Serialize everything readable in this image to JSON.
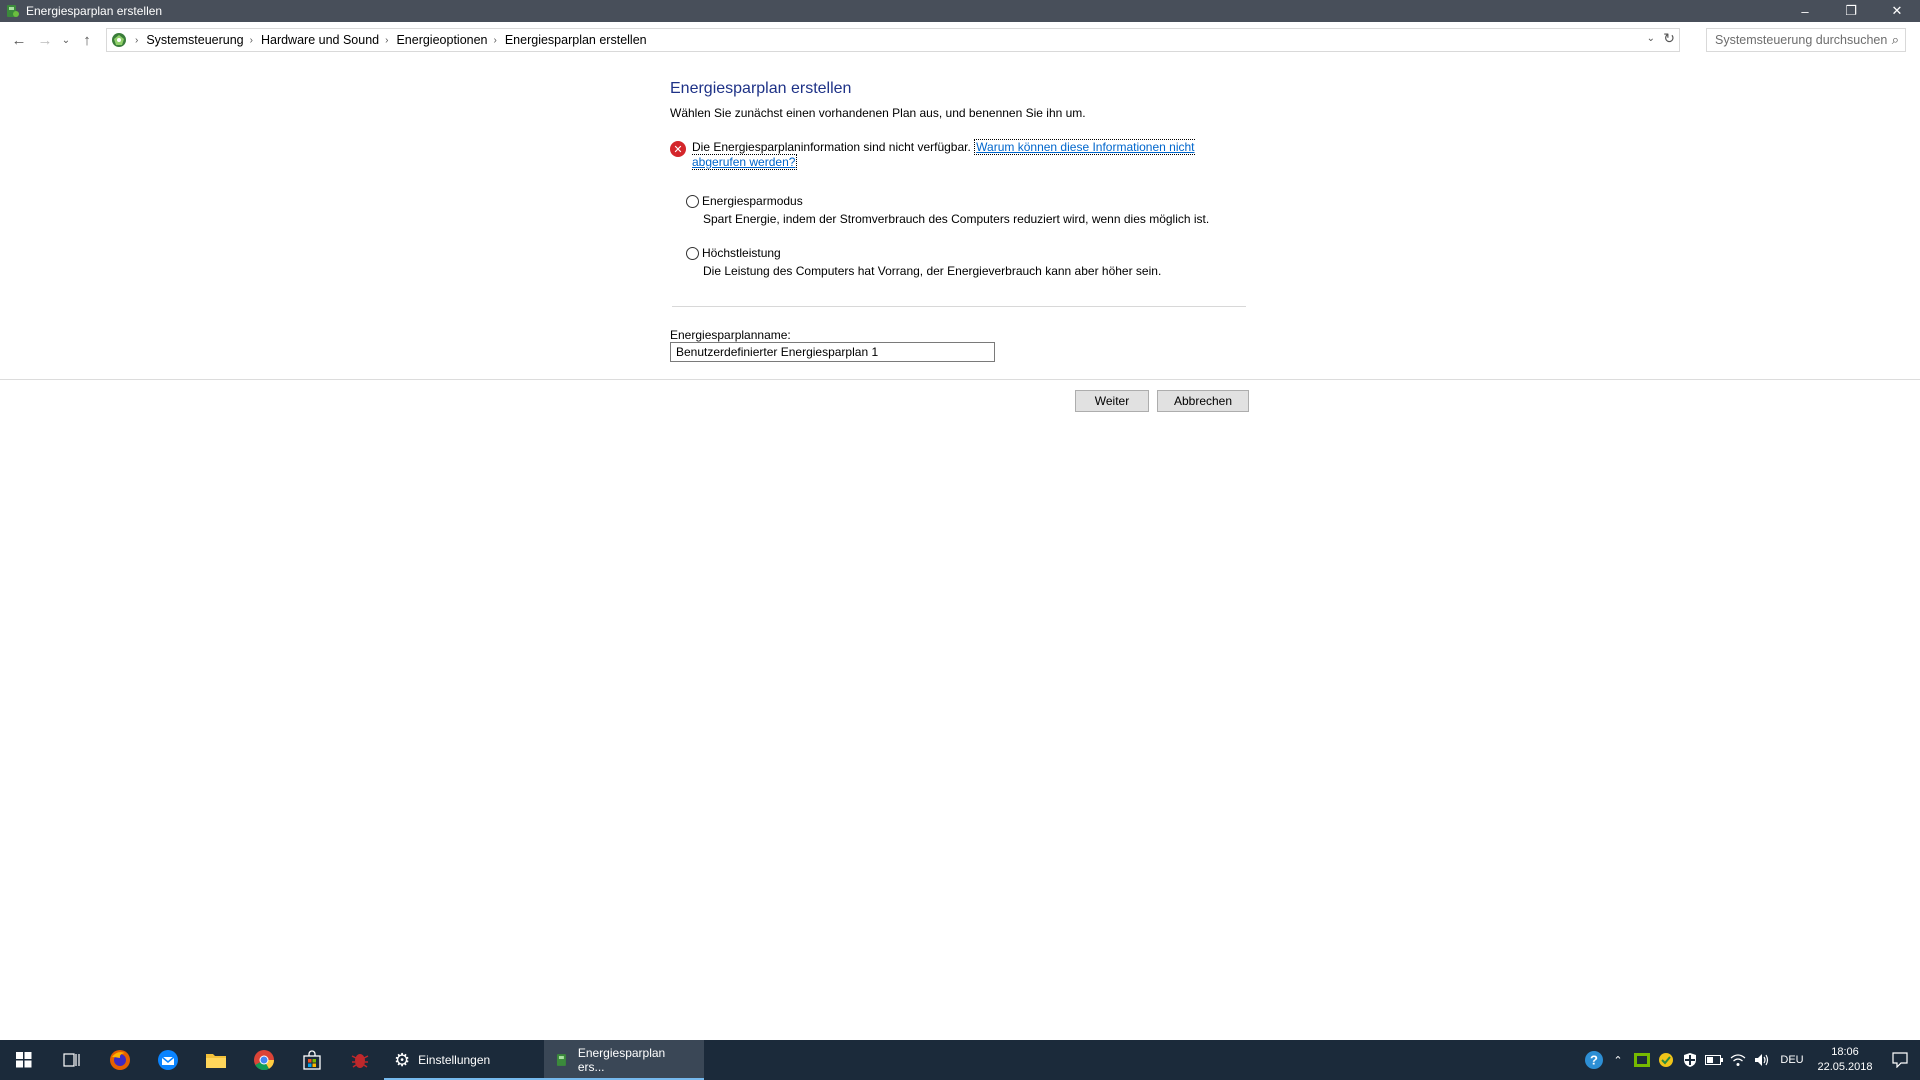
{
  "window": {
    "title": "Energiesparplan erstellen",
    "controls": {
      "minimize": "–",
      "restore": "❐",
      "close": "✕"
    }
  },
  "nav": {
    "back_glyph": "←",
    "forward_glyph": "→",
    "recent_glyph": "⌄",
    "up_glyph": "↑",
    "breadcrumbs": [
      "Systemsteuerung",
      "Hardware und Sound",
      "Energieoptionen",
      "Energiesparplan erstellen"
    ],
    "search_placeholder": "Systemsteuerung durchsuchen"
  },
  "main": {
    "heading": "Energiesparplan erstellen",
    "intro": "Wählen Sie zunächst einen vorhandenen Plan aus, und benennen Sie ihn um.",
    "error_text": "Die Energiesparplaninformation sind nicht verfügbar.",
    "error_link": "Warum können diese Informationen nicht abgerufen werden?",
    "plans": [
      {
        "name": "Energiesparmodus",
        "description": "Spart Energie, indem der Stromverbrauch des Computers reduziert wird, wenn dies möglich ist.",
        "selected": false
      },
      {
        "name": "Höchstleistung",
        "description": "Die Leistung des Computers hat Vorrang, der Energieverbrauch kann aber höher sein.",
        "selected": false
      }
    ],
    "name_label": "Energiesparplanname:",
    "name_value": "Benutzerdefinierter Energiesparplan 1",
    "next_button": "Weiter",
    "cancel_button": "Abbrechen"
  },
  "taskbar": {
    "apps": [
      {
        "label": "Einstellungen",
        "icon": "gear-icon"
      },
      {
        "label": "Energiesparplan ers...",
        "icon": "power-options-icon"
      }
    ],
    "language": "DEU",
    "time": "18:06",
    "date": "22.05.2018"
  },
  "colors": {
    "accent": "#1e3287",
    "link": "#0066cc",
    "titlebar": "#484f5a",
    "taskbar": "#1b2a3a",
    "error": "#d4262b"
  }
}
